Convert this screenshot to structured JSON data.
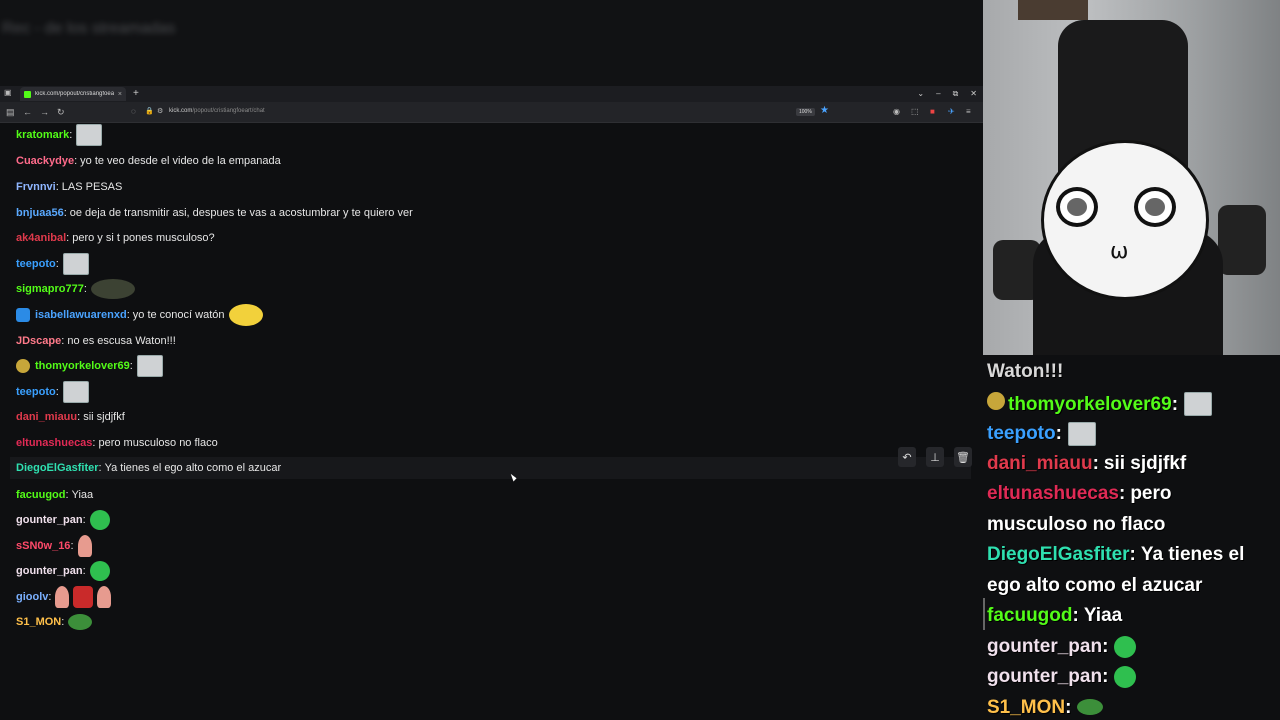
{
  "window_title_blurred": "Rec - de los streamadas",
  "browser": {
    "tab_title": "kick.com/popout/cristiangfoeart/chat",
    "url_host": "kick.com",
    "url_path": "/popout/cristiangfoeart/chat",
    "zoom": "100%"
  },
  "colors": {
    "kratomark": "#53fc18",
    "Cuackydye": "#ff6b8b",
    "Frvnnvi": "#8fb6ff",
    "bnjuaa56": "#5aa9ff",
    "ak4anibal": "#e03a4c",
    "teepoto": "#3aa0ff",
    "sigmapro777": "#53fc18",
    "isabellawuarenxd": "#4aa3ff",
    "JDscape": "#ff7a8a",
    "thomyorkelover69": "#53fc18",
    "dani_miauu": "#e03a4c",
    "eltunashuecas": "#e02a55",
    "DiegoElGasfiter": "#2fe0b0",
    "facuugod": "#53fc18",
    "gounter_pan": "#f0e0ec",
    "sSN0w_16": "#ff4a6a",
    "gioolv": "#7ab0ff",
    "S1_MON": "#ffc04a"
  },
  "chat": {
    "messages": [
      {
        "user": "kratomark",
        "text": "",
        "emotes": [
          "box"
        ]
      },
      {
        "user": "Cuackydye",
        "text": "yo te veo desde el video de la empanada",
        "emotes": []
      },
      {
        "user": "Frvnnvi",
        "text": "LAS PESAS",
        "emotes": []
      },
      {
        "user": "bnjuaa56",
        "text": "oe deja de transmitir asi, despues te vas a acostumbrar y te quiero ver",
        "emotes": []
      },
      {
        "user": "ak4anibal",
        "text": "pero y si t pones musculoso?",
        "emotes": []
      },
      {
        "user": "teepoto",
        "text": "",
        "emotes": [
          "box"
        ]
      },
      {
        "user": "sigmapro777",
        "text": "",
        "emotes": [
          "wide"
        ]
      },
      {
        "user": "isabellawuarenxd",
        "text": "yo te conocí watón",
        "emotes": [
          "yellow"
        ],
        "badge": "blue"
      },
      {
        "user": "JDscape",
        "text": "no es escusa Waton!!!",
        "emotes": []
      },
      {
        "user": "thomyorkelover69",
        "text": "",
        "emotes": [
          "box"
        ],
        "badge": "glasses"
      },
      {
        "user": "teepoto",
        "text": "",
        "emotes": [
          "box"
        ]
      },
      {
        "user": "dani_miauu",
        "text": "sii sjdjfkf",
        "emotes": []
      },
      {
        "user": "eltunashuecas",
        "text": "pero musculoso no flaco",
        "emotes": []
      },
      {
        "user": "DiegoElGasfiter",
        "text": "Ya tienes el ego alto como el azucar",
        "emotes": [],
        "highlight": true
      },
      {
        "user": "facuugod",
        "text": "Yiaa",
        "emotes": []
      },
      {
        "user": "gounter_pan",
        "text": "",
        "emotes": [
          "round"
        ]
      },
      {
        "user": "sSN0w_16",
        "text": "",
        "emotes": [
          "pink"
        ]
      },
      {
        "user": "gounter_pan",
        "text": "",
        "emotes": [
          "round"
        ]
      },
      {
        "user": "gioolv",
        "text": "",
        "emotes": [
          "pink",
          "red",
          "pink"
        ]
      },
      {
        "user": "S1_MON",
        "text": "",
        "emotes": [
          "frog"
        ]
      }
    ]
  },
  "overlay": {
    "lines": [
      {
        "user": "",
        "text": "Waton!!!",
        "emotes": []
      },
      {
        "user": "thomyorkelover69",
        "text": "",
        "emotes": [
          "box"
        ],
        "badge": "glasses"
      },
      {
        "user": "teepoto",
        "text": "",
        "emotes": [
          "box"
        ]
      },
      {
        "user": "dani_miauu",
        "text": "sii sjdjfkf",
        "emotes": []
      },
      {
        "user": "eltunashuecas",
        "text": "pero",
        "emotes": []
      },
      {
        "user": "",
        "text": "musculoso no flaco",
        "emotes": []
      },
      {
        "user": "DiegoElGasfiter",
        "text": "Ya tienes el",
        "emotes": []
      },
      {
        "user": "",
        "text": "ego alto como el azucar",
        "emotes": []
      },
      {
        "user": "facuugod",
        "text": "Yiaa",
        "emotes": []
      },
      {
        "user": "gounter_pan",
        "text": "",
        "emotes": [
          "round"
        ]
      },
      {
        "user": "gounter_pan",
        "text": "",
        "emotes": [
          "round"
        ]
      },
      {
        "user": "S1_MON",
        "text": "",
        "emotes": [
          "frog"
        ]
      }
    ]
  },
  "icons": [
    "sidebar-icon",
    "back-icon",
    "forward-icon",
    "reload-icon",
    "shield-icon",
    "lock-icon",
    "star-icon",
    "undo-icon",
    "pin-icon",
    "trash-icon"
  ]
}
